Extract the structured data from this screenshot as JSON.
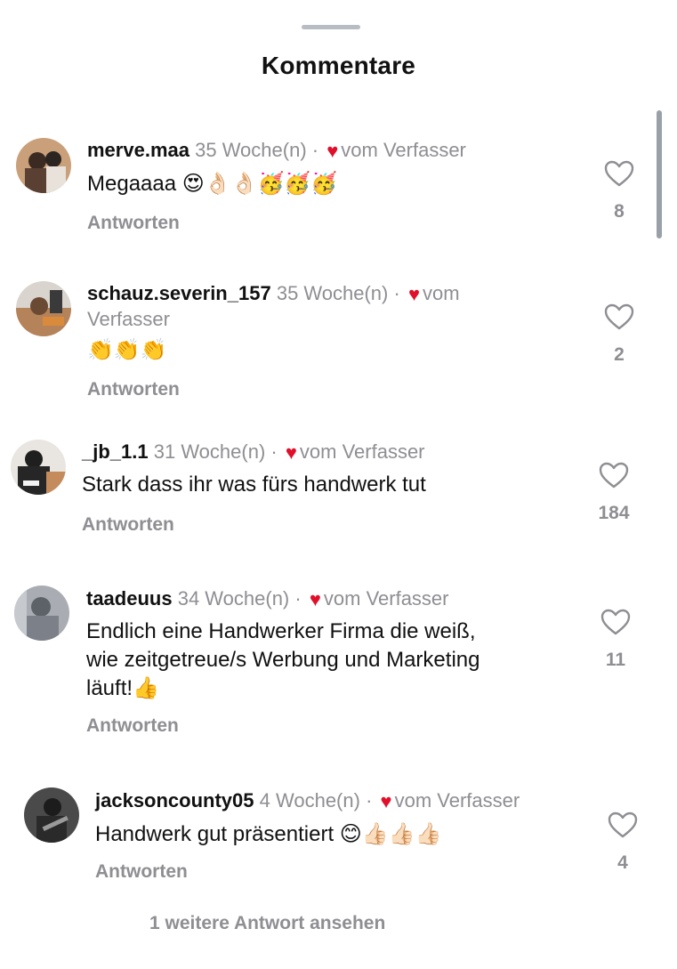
{
  "sheet": {
    "title": "Kommentare"
  },
  "comments": [
    {
      "username": "merve.maa",
      "time": "35 Woche(n)",
      "author_like": "vom Verfasser",
      "text": "Megaaaa 😍👌🏻👌🏻🥳🥳🥳",
      "reply_label": "Antworten",
      "likes": "8"
    },
    {
      "username": "schauz.severin_157",
      "time": "35 Woche(n)",
      "author_like": "vom Verfasser",
      "text": "👏👏👏",
      "reply_label": "Antworten",
      "likes": "2"
    },
    {
      "username": "_jb_1.1",
      "time": "31 Woche(n)",
      "author_like": "vom Verfasser",
      "text": "Stark dass ihr was fürs handwerk tut",
      "reply_label": "Antworten",
      "likes": "184"
    },
    {
      "username": "taadeuus",
      "time": "34 Woche(n)",
      "author_like": "vom Verfasser",
      "text": "Endlich eine Handwerker Firma die weiß,\nwie zeitgetreue/s Werbung und Marketing\nläuft!👍",
      "reply_label": "Antworten",
      "likes": "11"
    },
    {
      "username": "jacksoncounty05",
      "time": "4 Woche(n)",
      "author_like": "vom Verfasser",
      "text": "Handwerk gut präsentiert 😊👍🏻👍🏻👍🏻",
      "reply_label": "Antworten",
      "likes": "4"
    }
  ],
  "more_replies": "1 weitere Antwort ansehen",
  "icons": {
    "author_heart": "heart-filled-icon",
    "like": "heart-outline-icon"
  },
  "colors": {
    "author_heart": "#e0102b",
    "secondary_text": "#8e8e93"
  }
}
